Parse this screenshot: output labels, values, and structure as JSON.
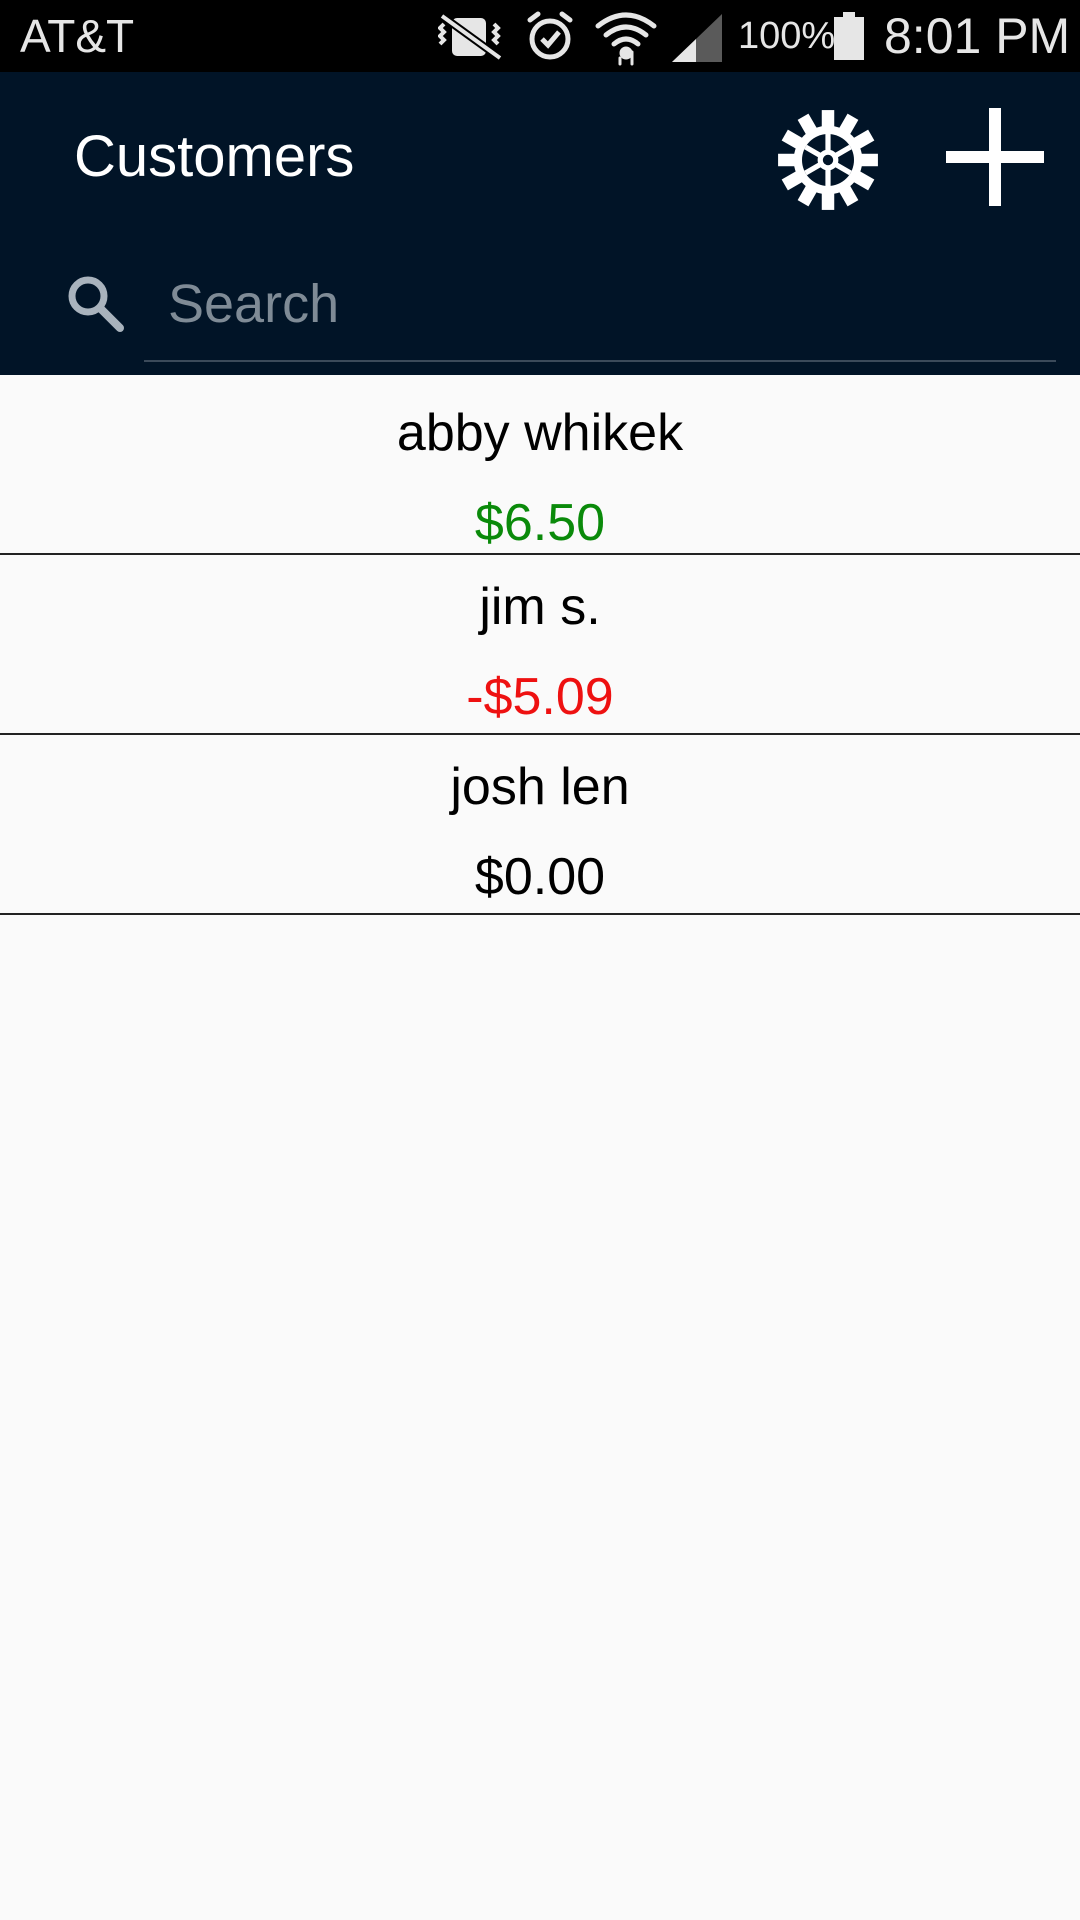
{
  "status_bar": {
    "carrier": "AT&T",
    "battery": "100%",
    "time": "8:01 PM",
    "icons": [
      "vibrate-mute-icon",
      "alarm-icon",
      "wifi-icon",
      "signal-icon",
      "battery-icon"
    ]
  },
  "app_bar": {
    "title": "Customers",
    "settings_icon": "gear-icon",
    "add_icon": "plus-icon",
    "search": {
      "placeholder": "Search",
      "value": ""
    },
    "background": "#011427"
  },
  "customers": [
    {
      "name": "abby whikek",
      "balance": "$6.50",
      "balance_color": "#0a8a0a"
    },
    {
      "name": "jim s.",
      "balance": "-$5.09",
      "balance_color": "#ee1111"
    },
    {
      "name": "josh len",
      "balance": "$0.00",
      "balance_color": "#000000"
    }
  ]
}
